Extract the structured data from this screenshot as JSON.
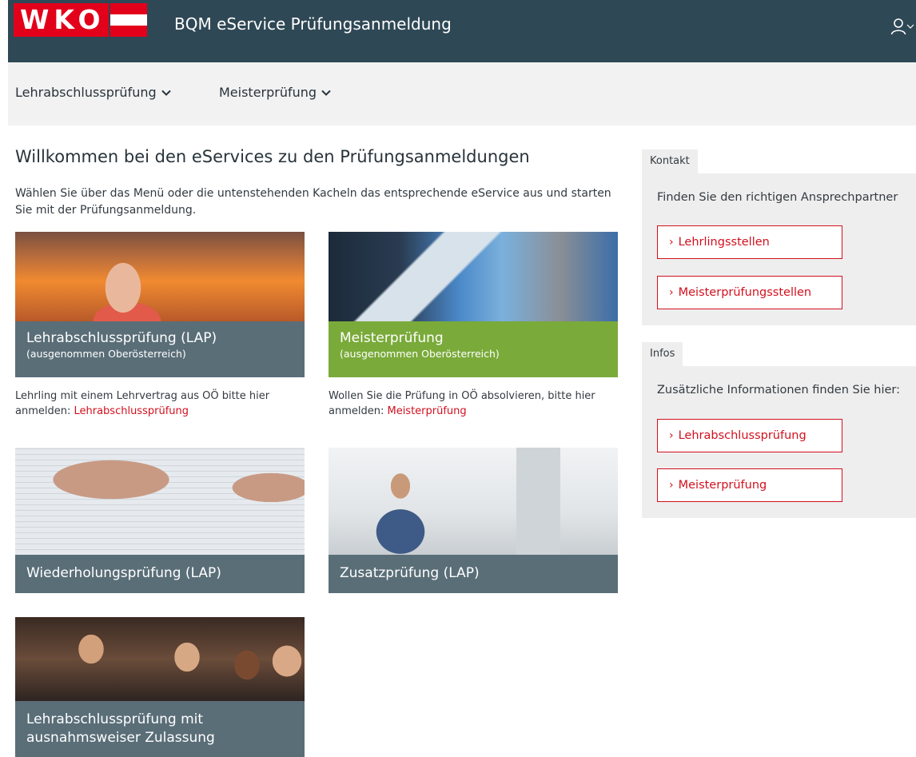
{
  "header": {
    "logo_text": "WKO",
    "app_title": "BQM eService Prüfungsanmeldung"
  },
  "nav": {
    "items": [
      {
        "label": "Lehrabschlussprüfung"
      },
      {
        "label": "Meisterprüfung"
      }
    ]
  },
  "main": {
    "title": "Willkommen bei den eServices zu den Prüfungsanmeldungen",
    "intro": "Wählen Sie über das Menü oder die untenstehenden Kacheln das entsprechende eService aus und starten Sie mit der Prüfungsanmeldung.",
    "tiles": [
      {
        "title": "Lehrabschlussprüfung (LAP)",
        "subtitle": "(ausgenommen Oberösterreich)",
        "scene": "woman-at-desk-office",
        "note_text": "Lehrling mit einem Lehrvertrag aus OÖ bitte hier anmelden: ",
        "note_link": "Lehrabschlussprüfung"
      },
      {
        "title": "Meisterprüfung",
        "subtitle": "(ausgenommen Oberösterreich)",
        "scene": "business-people-documents",
        "note_text": "Wollen Sie die Prüfung in OÖ absolvieren, bitte hier anmelden: ",
        "note_link": "Meisterprüfung"
      },
      {
        "title": "Wiederholungsprüfung (LAP)",
        "scene": "hand-filling-form"
      },
      {
        "title": "Zusatzprüfung (LAP)",
        "scene": "man-at-computer"
      },
      {
        "title": "Lehrabschlussprüfung mit ausnahmsweiser Zulassung",
        "scene": "group-of-young-people"
      }
    ]
  },
  "sidebar": {
    "kontakt": {
      "tab_label": "Kontakt",
      "lead": "Finden Sie den richtigen Ansprechpartner",
      "links": [
        {
          "label": "Lehrlingsstellen"
        },
        {
          "label": "Meisterprüfungsstellen"
        }
      ]
    },
    "infos": {
      "tab_label": "Infos",
      "lead": "Zusätzliche Informationen finden Sie hier:",
      "links": [
        {
          "label": "Lehrabschlussprüfung"
        },
        {
          "label": "Meisterprüfung"
        }
      ]
    }
  },
  "colors": {
    "header_bg": "#2f4855",
    "brand_red": "#e2001a",
    "link_red": "#d2101e",
    "tile_caption": "#5a6e78",
    "tile_caption_green": "#7aaa3a",
    "panel_bg": "#eeeeee"
  },
  "icons": {
    "user_menu": "user-icon",
    "nav_dropdown": "chevron-down-icon",
    "link_arrow": "chevron-right-icon"
  }
}
